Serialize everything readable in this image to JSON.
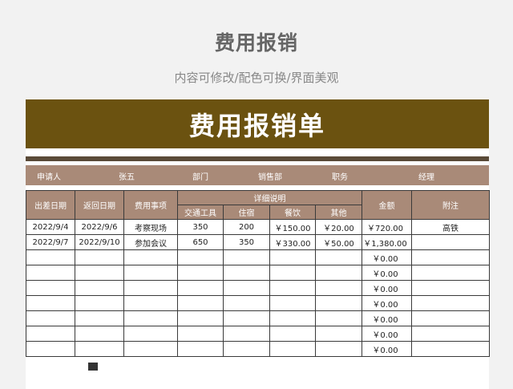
{
  "page": {
    "title": "费用报销",
    "subtitle": "内容可修改/配色可换/界面美观"
  },
  "form": {
    "title": "费用报销单",
    "info": {
      "applicant_label": "申请人",
      "applicant": "张五",
      "dept_label": "部门",
      "dept": "销售部",
      "position_label": "职务",
      "position": "经理"
    },
    "headers": {
      "depart_date": "出差日期",
      "return_date": "返回日期",
      "item": "费用事项",
      "detail": "详细说明",
      "transport": "交通工具",
      "lodging": "住宿",
      "meals": "餐饮",
      "other": "其他",
      "amount": "金额",
      "note": "附注"
    },
    "rows": [
      [
        "2022/9/4",
        "2022/9/6",
        "考察现场",
        "350",
        "200",
        "￥150.00",
        "￥20.00",
        "￥720.00",
        "高铁"
      ],
      [
        "2022/9/7",
        "2022/9/10",
        "参加会议",
        "650",
        "350",
        "￥330.00",
        "￥50.00",
        "￥1,380.00",
        ""
      ],
      [
        "",
        "",
        "",
        "",
        "",
        "",
        "",
        "￥0.00",
        ""
      ],
      [
        "",
        "",
        "",
        "",
        "",
        "",
        "",
        "￥0.00",
        ""
      ],
      [
        "",
        "",
        "",
        "",
        "",
        "",
        "",
        "￥0.00",
        ""
      ],
      [
        "",
        "",
        "",
        "",
        "",
        "",
        "",
        "￥0.00",
        ""
      ],
      [
        "",
        "",
        "",
        "",
        "",
        "",
        "",
        "￥0.00",
        ""
      ],
      [
        "",
        "",
        "",
        "",
        "",
        "",
        "",
        "￥0.00",
        ""
      ],
      [
        "",
        "",
        "",
        "",
        "",
        "",
        "",
        "￥0.00",
        ""
      ]
    ],
    "colors": {
      "banner": "#6b5210",
      "header": "#a98a78",
      "bar": "#5a4a38"
    }
  }
}
